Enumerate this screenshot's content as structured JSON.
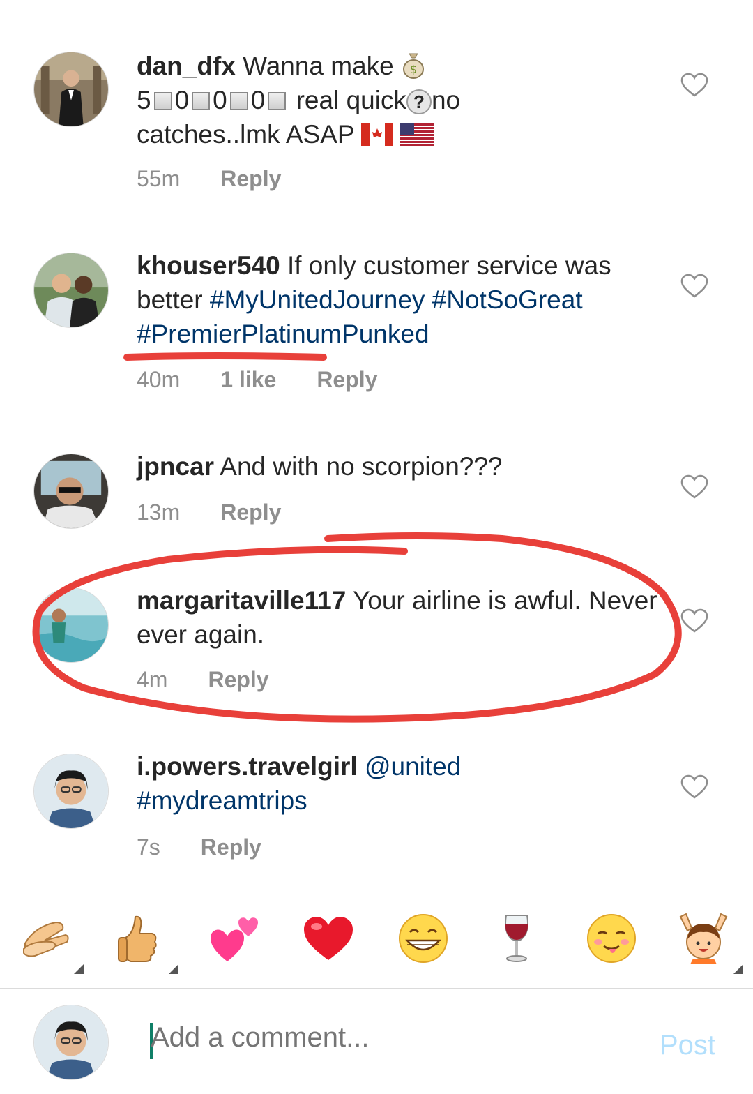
{
  "comments": [
    {
      "username": "dan_dfx",
      "text_1": "Wanna make",
      "text_2": "real quick",
      "text_3": "no",
      "text_4": "catches..lmk ASAP",
      "digits": [
        "5",
        "0",
        "0",
        "0"
      ],
      "time": "55m",
      "reply": "Reply"
    },
    {
      "username": "khouser540",
      "text": "If only customer service was better",
      "tags": [
        "#MyUnitedJourney",
        "#NotSoGreat",
        "#PremierPlatinumPunked"
      ],
      "time": "40m",
      "likes": "1 like",
      "reply": "Reply"
    },
    {
      "username": "jpncar",
      "text": "And with no scorpion???",
      "time": "13m",
      "reply": "Reply"
    },
    {
      "username": "margaritaville117",
      "text": "Your airline is awful. Never ever again.",
      "time": "4m",
      "reply": "Reply"
    },
    {
      "username": "i.powers.travelgirl",
      "mention": "@united",
      "tag": "#mydreamtrips",
      "time": "7s",
      "reply": "Reply"
    }
  ],
  "emoji_bar": [
    "clapping-hands",
    "thumbs-up",
    "two-hearts",
    "red-heart",
    "grinning-face",
    "wine-glass",
    "tongue-face",
    "raised-hands-person"
  ],
  "composer": {
    "placeholder": "Add a comment...",
    "post_label": "Post"
  },
  "colors": {
    "hashtag": "#003569",
    "meta": "#8e8e8e",
    "post_disabled": "#b2dffc",
    "annotation": "#e8403a"
  }
}
